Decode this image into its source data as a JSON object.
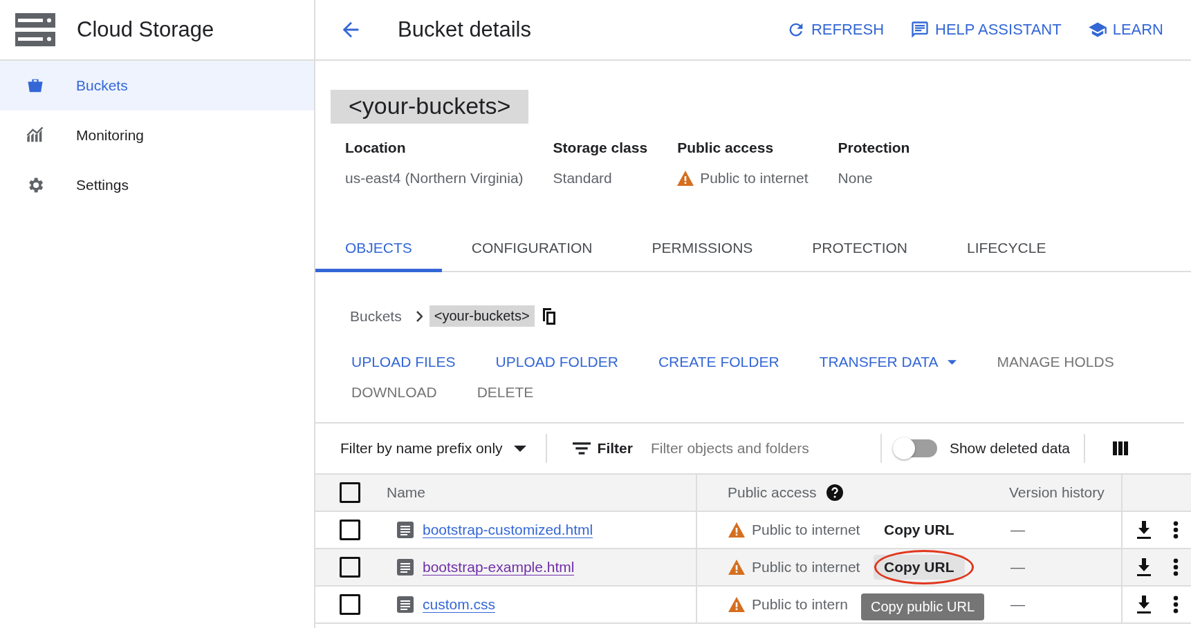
{
  "app": {
    "title": "Cloud Storage"
  },
  "nav": [
    {
      "label": "Buckets",
      "selected": true
    },
    {
      "label": "Monitoring",
      "selected": false
    },
    {
      "label": "Settings",
      "selected": false
    }
  ],
  "header": {
    "title": "Bucket details",
    "actions": [
      "REFRESH",
      "HELP ASSISTANT",
      "LEARN"
    ]
  },
  "bucket": {
    "name": "<your-buckets>",
    "properties": [
      {
        "label": "Location",
        "value": "us-east4 (Northern Virginia)",
        "warning": false
      },
      {
        "label": "Storage class",
        "value": "Standard",
        "warning": false
      },
      {
        "label": "Public access",
        "value": "Public to internet",
        "warning": true
      },
      {
        "label": "Protection",
        "value": "None",
        "warning": false
      }
    ]
  },
  "tabs": [
    {
      "label": "OBJECTS",
      "selected": true
    },
    {
      "label": "CONFIGURATION",
      "selected": false
    },
    {
      "label": "PERMISSIONS",
      "selected": false
    },
    {
      "label": "PROTECTION",
      "selected": false
    },
    {
      "label": "LIFECYCLE",
      "selected": false
    }
  ],
  "breadcrumb": {
    "root": "Buckets",
    "current": "<your-buckets>"
  },
  "actions": [
    {
      "label": "UPLOAD FILES",
      "disabled": false,
      "dropdown": false
    },
    {
      "label": "UPLOAD FOLDER",
      "disabled": false,
      "dropdown": false
    },
    {
      "label": "CREATE FOLDER",
      "disabled": false,
      "dropdown": false
    },
    {
      "label": "TRANSFER DATA",
      "disabled": false,
      "dropdown": true
    },
    {
      "label": "MANAGE HOLDS",
      "disabled": true,
      "dropdown": false
    },
    {
      "label": "DOWNLOAD",
      "disabled": true,
      "dropdown": false
    },
    {
      "label": "DELETE",
      "disabled": true,
      "dropdown": false
    }
  ],
  "filter_bar": {
    "mode": "Filter by name prefix only",
    "filter_label": "Filter",
    "placeholder": "Filter objects and folders",
    "show_deleted": {
      "label": "Show deleted data",
      "on": false
    }
  },
  "table": {
    "columns": [
      "Name",
      "Public access",
      "Version history"
    ],
    "all_checked": false,
    "rows": [
      {
        "name": "bootstrap-customized.html",
        "visited": false,
        "hovered": false,
        "checked": false,
        "access": "Public to internet",
        "copy_url": "Copy URL",
        "copy_hovered": false,
        "annotated": false,
        "version": "—"
      },
      {
        "name": "bootstrap-example.html",
        "visited": true,
        "hovered": true,
        "checked": false,
        "access": "Public to internet",
        "copy_url": "Copy URL",
        "copy_hovered": true,
        "annotated": true,
        "version": "—"
      },
      {
        "name": "custom.css",
        "visited": false,
        "hovered": false,
        "checked": false,
        "access": "Public to intern",
        "tooltip": "Copy public URL",
        "version": "—"
      }
    ]
  }
}
